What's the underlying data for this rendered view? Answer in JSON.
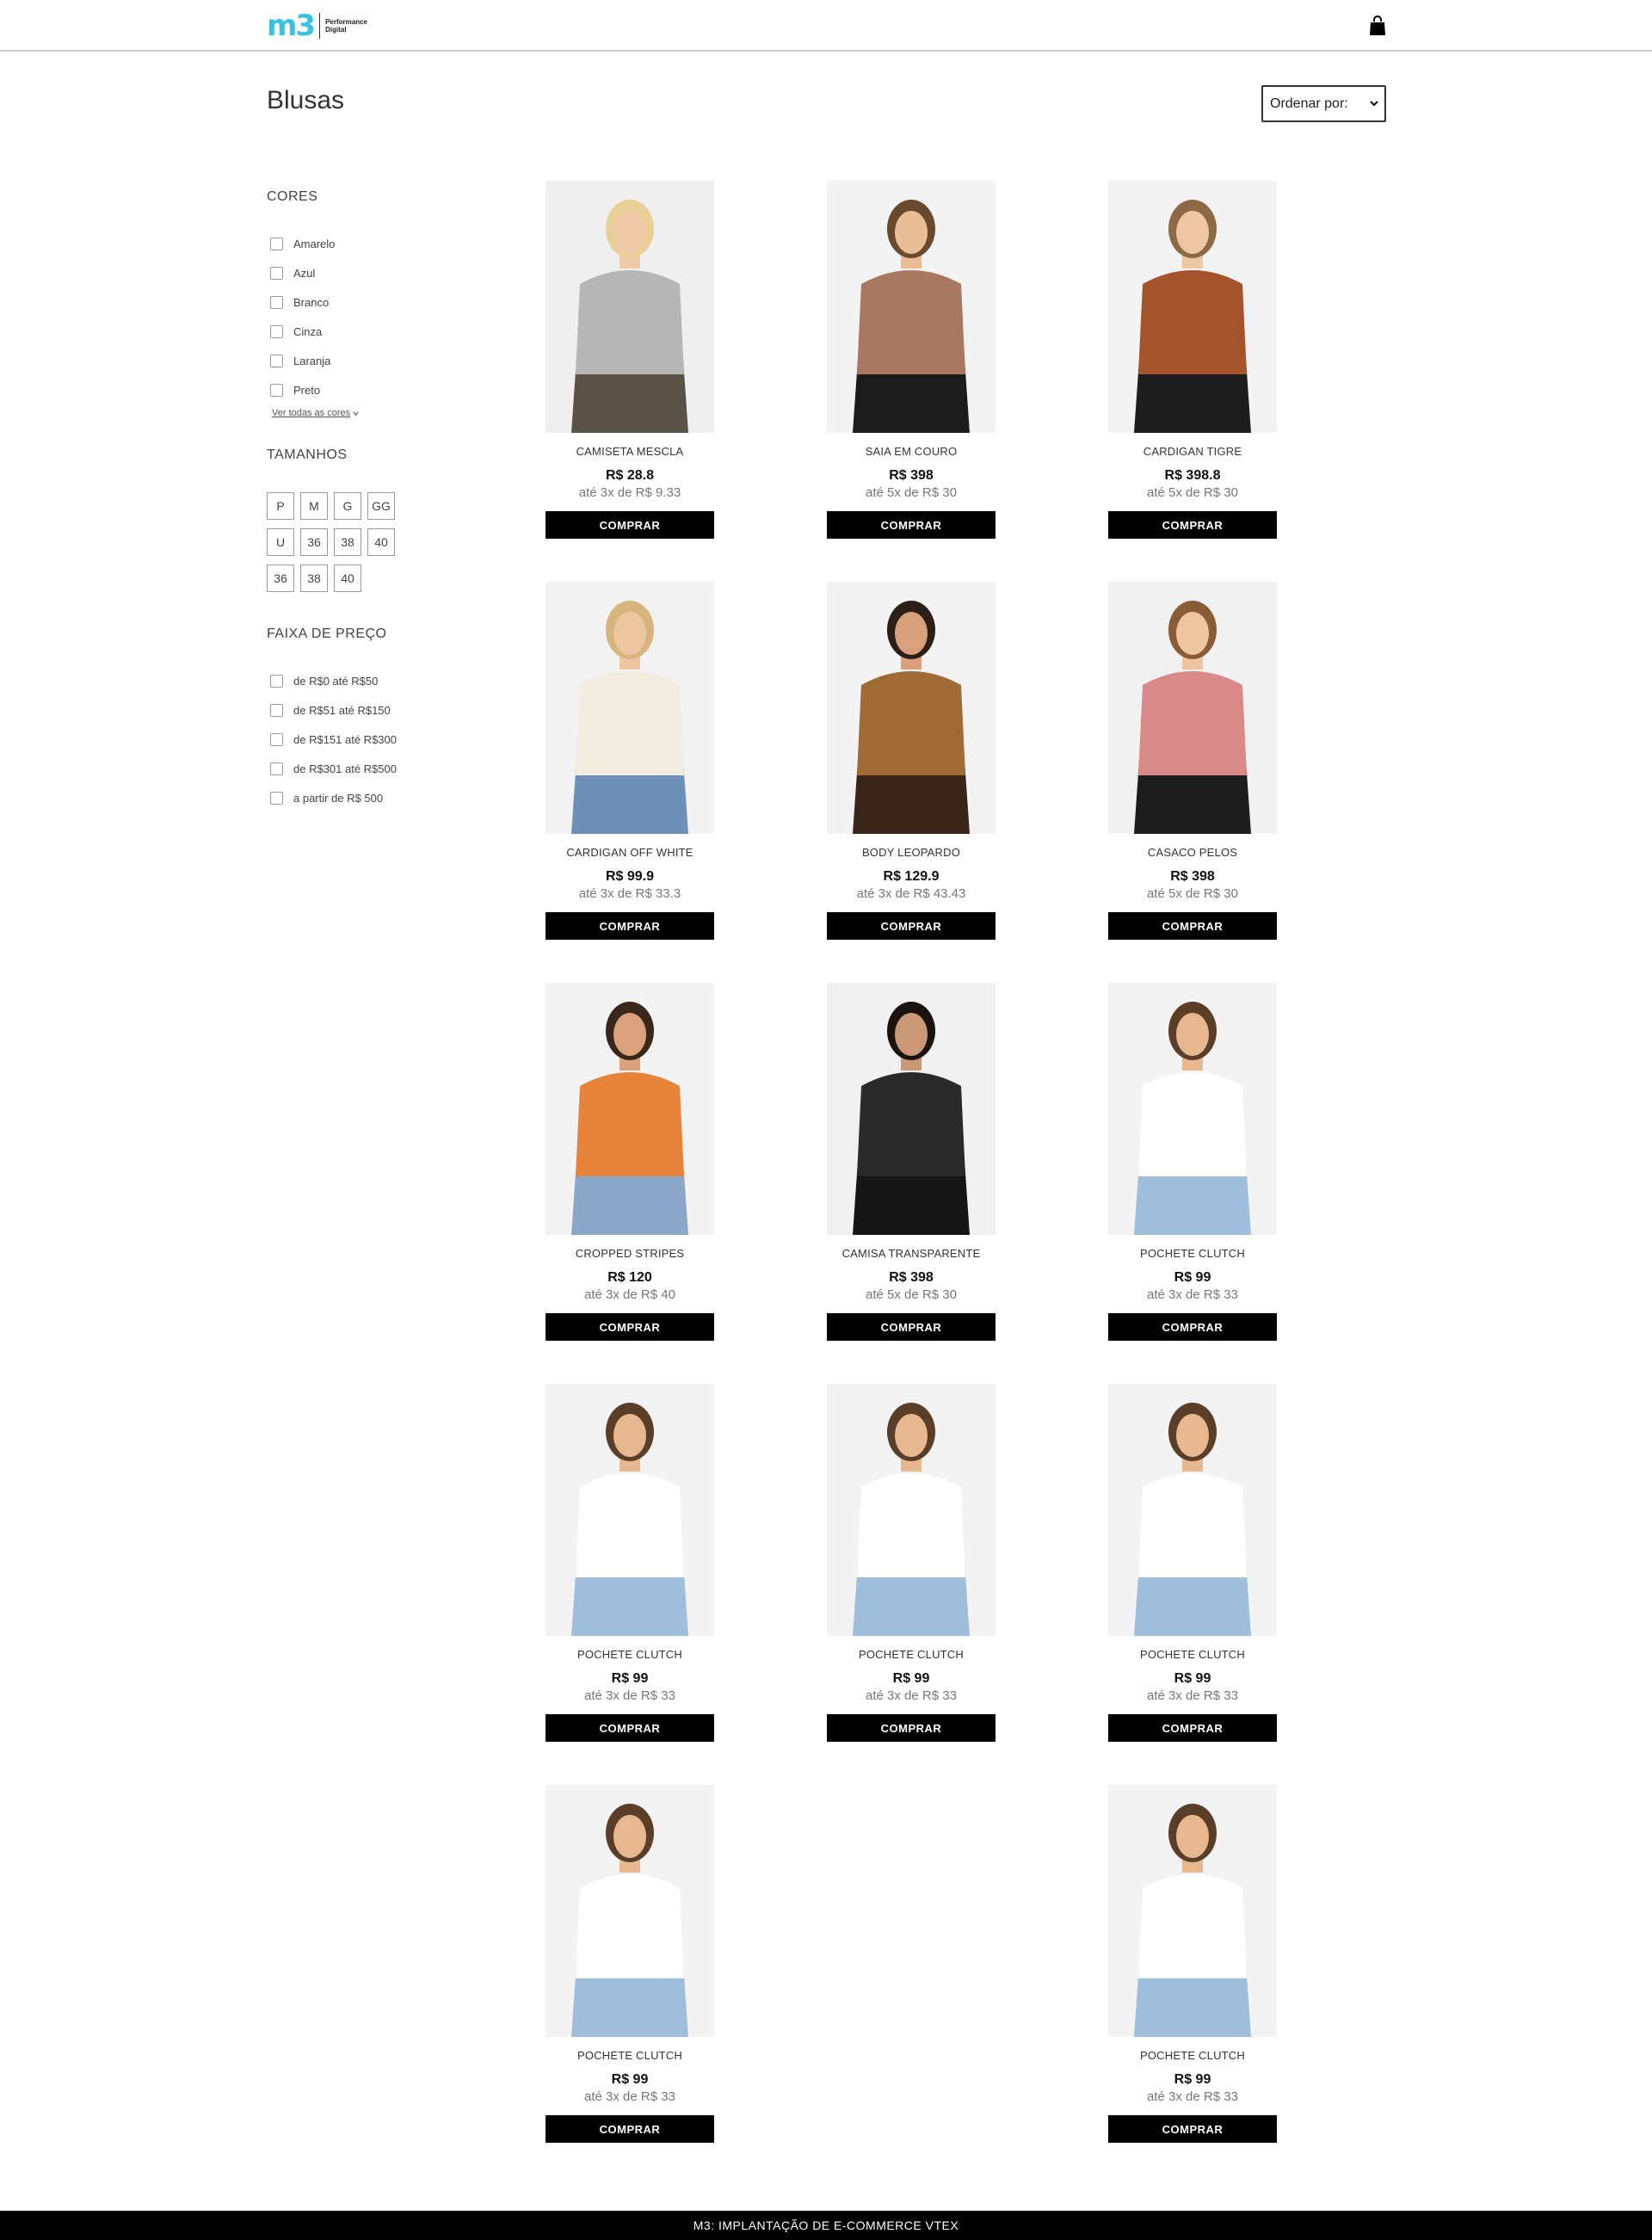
{
  "header": {
    "logo_mark": "m3",
    "logo_line1": "Performance",
    "logo_line2": "Digital",
    "cart_icon": "shopping-bag-icon"
  },
  "page": {
    "title": "Blusas",
    "sort_label": "Ordenar por:"
  },
  "filters": {
    "colors_heading": "CORES",
    "colors": [
      "Amarelo",
      "Azul",
      "Branco",
      "Cinza",
      "Laranja",
      "Preto"
    ],
    "see_all": "Ver todas as cores",
    "sizes_heading": "TAMANHOS",
    "sizes": [
      "P",
      "M",
      "G",
      "GG",
      "U",
      "36",
      "38",
      "40",
      "36",
      "38",
      "40"
    ],
    "price_heading": "FAIXA DE PREÇO",
    "price_ranges": [
      "de R$0 até R$50",
      "de R$51 até R$150",
      "de R$151 até R$300",
      "de R$301 até R$500",
      "a partir de R$ 500"
    ]
  },
  "buy_label": "COMPRAR",
  "products": [
    {
      "name": "CAMISETA MESCLA",
      "price": "R$ 28.8",
      "installments": "até 3x de R$ 9.33",
      "bg": "#efefef",
      "top": "#b6b6b6",
      "skin": "#f0c9a8",
      "hair": "#e8cf96",
      "bottom": "#5a5247"
    },
    {
      "name": "SAIA EM COURO",
      "price": "R$ 398",
      "installments": "até 5x de R$ 30",
      "bg": "#f3f3f3",
      "top": "#a87862",
      "skin": "#e9bd96",
      "hair": "#6a4a2e",
      "bottom": "#1c1c1c"
    },
    {
      "name": "CARDIGAN TIGRE",
      "price": "R$ 398.8",
      "installments": "até 5x de R$ 30",
      "bg": "#f3f3f3",
      "top": "#a4532b",
      "skin": "#efc6a3",
      "hair": "#8d6a45",
      "bottom": "#1d1d1d"
    },
    {
      "name": "CARDIGAN OFF WHITE",
      "price": "R$ 99.9",
      "installments": "até 3x de R$ 33.3",
      "bg": "#f2f2f2",
      "top": "#f2ede0",
      "skin": "#eec5a1",
      "hair": "#d6b47b",
      "bottom": "#6d8fb8"
    },
    {
      "name": "BODY LEOPARDO",
      "price": "R$ 129.9",
      "installments": "até 3x de R$ 43.43",
      "bg": "#f3f3f3",
      "top": "#a06a35",
      "skin": "#d8a17b",
      "hair": "#2b1f18",
      "bottom": "#3a2619"
    },
    {
      "name": "CASACO PELOS",
      "price": "R$ 398",
      "installments": "até 5x de R$ 30",
      "bg": "#f1f1f1",
      "top": "#d98a88",
      "skin": "#efc4a0",
      "hair": "#8a5c35",
      "bottom": "#1d1d1d"
    },
    {
      "name": "CROPPED STRIPES",
      "price": "R$ 120",
      "installments": "até 3x de R$ 40",
      "bg": "#f3f3f3",
      "top": "#e5843a",
      "skin": "#d9a27c",
      "hair": "#3a271b",
      "bottom": "#8aa6c9"
    },
    {
      "name": "CAMISA TRANSPARENTE",
      "price": "R$ 398",
      "installments": "até 5x de R$ 30",
      "bg": "#f1f1f1",
      "top": "#2a2a2a",
      "skin": "#c99876",
      "hair": "#1a1410",
      "bottom": "#151515"
    },
    {
      "name": "POCHETE CLUTCH",
      "price": "R$ 99",
      "installments": "até 3x de R$ 33",
      "bg": "#f3f3f3",
      "top": "#ffffff",
      "skin": "#e7b890",
      "hair": "#5b3e27",
      "bottom": "#9fbedb"
    },
    {
      "name": "POCHETE CLUTCH",
      "price": "R$ 99",
      "installments": "até 3x de R$ 33",
      "bg": "#f3f3f3",
      "top": "#ffffff",
      "skin": "#e7b890",
      "hair": "#5b3e27",
      "bottom": "#9fbedb"
    },
    {
      "name": "POCHETE CLUTCH",
      "price": "R$ 99",
      "installments": "até 3x de R$ 33",
      "bg": "#f3f3f3",
      "top": "#ffffff",
      "skin": "#e7b890",
      "hair": "#5b3e27",
      "bottom": "#9fbedb"
    },
    {
      "name": "POCHETE CLUTCH",
      "price": "R$ 99",
      "installments": "até 3x de R$ 33",
      "bg": "#f3f3f3",
      "top": "#ffffff",
      "skin": "#e7b890",
      "hair": "#5b3e27",
      "bottom": "#9fbedb"
    },
    {
      "name": "POCHETE CLUTCH",
      "price": "R$ 99",
      "installments": "até 3x de R$ 33",
      "bg": "#f3f3f3",
      "top": "#ffffff",
      "skin": "#e7b890",
      "hair": "#5b3e27",
      "bottom": "#9fbedb"
    },
    {
      "name": "POCHETE CLUTCH",
      "price": "R$ 99",
      "installments": "até 3x de R$ 33",
      "bg": "#f3f3f3",
      "top": "#ffffff",
      "skin": "#e7b890",
      "hair": "#5b3e27",
      "bottom": "#9fbedb"
    }
  ],
  "footer": {
    "text": "M3: IMPLANTAÇÃO DE E-COMMERCE VTEX"
  }
}
